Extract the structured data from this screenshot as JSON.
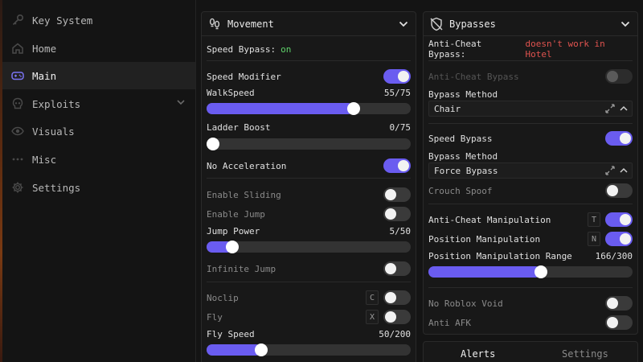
{
  "sidebar": {
    "items": [
      {
        "label": "Key System",
        "icon": "key-icon",
        "active": false
      },
      {
        "label": "Home",
        "icon": "home-icon",
        "active": false
      },
      {
        "label": "Main",
        "icon": "gamepad-icon",
        "active": true
      },
      {
        "label": "Exploits",
        "icon": "skull-icon",
        "active": false,
        "expandable": true
      },
      {
        "label": "Visuals",
        "icon": "eye-icon",
        "active": false
      },
      {
        "label": "Misc",
        "icon": "dots-icon",
        "active": false
      },
      {
        "label": "Settings",
        "icon": "gear-icon",
        "active": false
      }
    ]
  },
  "movement": {
    "title": "Movement",
    "speed_bypass_label": "Speed Bypass:",
    "speed_bypass_value": "on",
    "speed_modifier": {
      "label": "Speed Modifier",
      "on": true
    },
    "walkspeed": {
      "label": "WalkSpeed",
      "value": 55,
      "max": 75,
      "display": "55/75"
    },
    "ladder_boost": {
      "label": "Ladder Boost",
      "value": 0,
      "max": 75,
      "display": "0/75"
    },
    "no_acceleration": {
      "label": "No Acceleration",
      "on": true
    },
    "enable_sliding": {
      "label": "Enable Sliding",
      "on": false
    },
    "enable_jump": {
      "label": "Enable Jump",
      "on": false
    },
    "jump_power": {
      "label": "Jump Power",
      "value": 5,
      "max": 50,
      "display": "5/50"
    },
    "infinite_jump": {
      "label": "Infinite Jump",
      "on": false
    },
    "noclip": {
      "label": "Noclip",
      "key": "C",
      "on": false
    },
    "fly": {
      "label": "Fly",
      "key": "X",
      "on": false
    },
    "fly_speed": {
      "label": "Fly Speed",
      "value": 50,
      "max": 200,
      "display": "50/200"
    }
  },
  "bypasses": {
    "title": "Bypasses",
    "anticheat_status_label": "Anti-Cheat Bypass:",
    "anticheat_status_value": "doesn't work in Hotel",
    "anticheat_bypass": {
      "label": "Anti-Cheat Bypass",
      "on": false,
      "disabled": true
    },
    "bypass_method_label_1": "Bypass Method",
    "bypass_method_value_1": "Chair",
    "speed_bypass": {
      "label": "Speed Bypass",
      "on": true
    },
    "bypass_method_label_2": "Bypass Method",
    "bypass_method_value_2": "Force Bypass",
    "crouch_spoof": {
      "label": "Crouch Spoof",
      "on": false
    },
    "anticheat_manipulation": {
      "label": "Anti-Cheat Manipulation",
      "key": "T",
      "on": true
    },
    "position_manipulation": {
      "label": "Position Manipulation",
      "key": "N",
      "on": true
    },
    "position_range": {
      "label": "Position Manipulation Range",
      "value": 166,
      "max": 300,
      "display": "166/300"
    },
    "no_roblox_void": {
      "label": "No Roblox Void",
      "on": false
    },
    "anti_afk": {
      "label": "Anti AFK",
      "on": false
    }
  },
  "bottom_tabs": {
    "alerts": "Alerts",
    "settings": "Settings"
  },
  "colors": {
    "accent": "#6a5cf0",
    "on_text": "#5fd36a",
    "warn_text": "#e0534f"
  }
}
